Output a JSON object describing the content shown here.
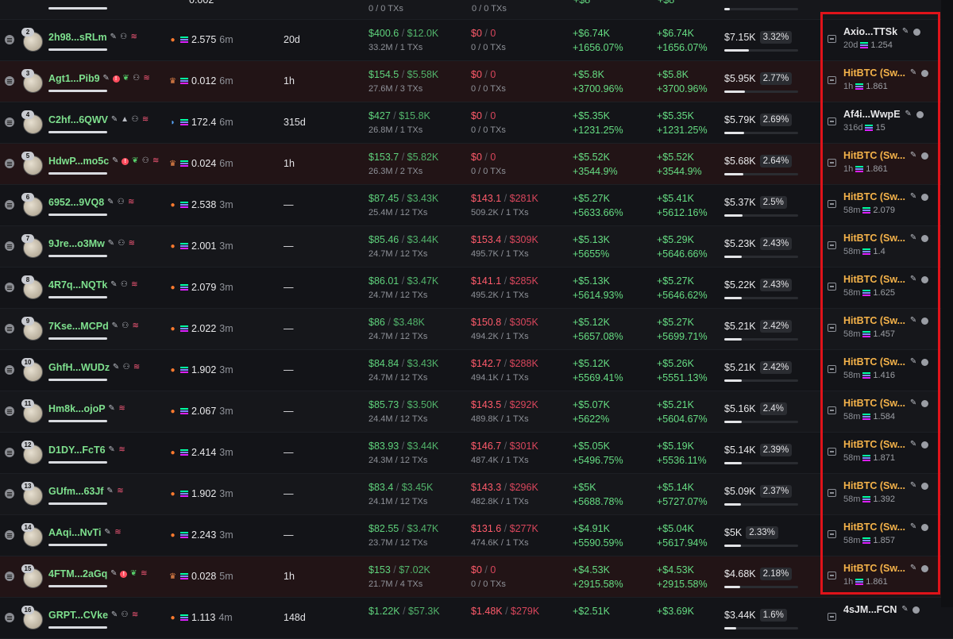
{
  "columns_note": "",
  "top_partial": {
    "balance": "0.002",
    "txs_bought": "0 / 0 TXs",
    "txs_sold": "0 / 0 TXs",
    "pnl1": "+$8",
    "pnl2": "+$8"
  },
  "rows": [
    {
      "rank": "2",
      "wallet": "2h98...sRLm",
      "badges": [
        "edit",
        "user",
        "stack"
      ],
      "alert": false,
      "leaf": false,
      "src": "fire",
      "balance": "2.575",
      "bal_time": "6m",
      "duration": "20d",
      "bought_usd": "$400.6",
      "bought_total": "$12.0K",
      "bought_sub": "33.2M / 1 TXs",
      "sold_usd": "$0",
      "sold_total": "0",
      "sold_sub": "0 / 0 TXs",
      "pnl_a": "+$6.74K",
      "pnl_a_pct": "+1656.07%",
      "pnl_b": "+$6.74K",
      "pnl_b_pct": "+1656.07%",
      "pnl_usd": "$7.15K",
      "pnl_share": "3.32%",
      "bar": 0.33,
      "fund_name": "Axio...TTSk",
      "fund_orange": false,
      "fund_time": "20d",
      "fund_amount": "1.254",
      "tone": "even"
    },
    {
      "rank": "3",
      "wallet": "Agt1...Pib9",
      "badges": [
        "edit",
        "user",
        "stack"
      ],
      "alert": true,
      "leaf": true,
      "src": "crown",
      "balance": "0.012",
      "bal_time": "6m",
      "duration": "1h",
      "bought_usd": "$154.5",
      "bought_total": "$5.58K",
      "bought_sub": "27.6M / 3 TXs",
      "sold_usd": "$0",
      "sold_total": "0",
      "sold_sub": "0 / 0 TXs",
      "pnl_a": "+$5.8K",
      "pnl_a_pct": "+3700.96%",
      "pnl_b": "+$5.8K",
      "pnl_b_pct": "+3700.96%",
      "pnl_usd": "$5.95K",
      "pnl_share": "2.77%",
      "bar": 0.28,
      "fund_name": "HitBTC (Sw...",
      "fund_orange": true,
      "fund_time": "1h",
      "fund_amount": "1.861",
      "tone": "hl"
    },
    {
      "rank": "4",
      "wallet": "C2hf...6QWV",
      "badges": [
        "edit",
        "tri",
        "user",
        "stack"
      ],
      "alert": false,
      "leaf": false,
      "src": "dolphin",
      "balance": "172.4",
      "bal_time": "6m",
      "duration": "315d",
      "bought_usd": "$427",
      "bought_total": "$15.8K",
      "bought_sub": "26.8M / 1 TXs",
      "sold_usd": "$0",
      "sold_total": "0",
      "sold_sub": "0 / 0 TXs",
      "pnl_a": "+$5.35K",
      "pnl_a_pct": "+1231.25%",
      "pnl_b": "+$5.35K",
      "pnl_b_pct": "+1231.25%",
      "pnl_usd": "$5.79K",
      "pnl_share": "2.69%",
      "bar": 0.27,
      "fund_name": "Af4i...WwpE",
      "fund_orange": false,
      "fund_time": "316d",
      "fund_amount": "15",
      "tone": "even"
    },
    {
      "rank": "5",
      "wallet": "HdwP...mo5c",
      "badges": [
        "edit",
        "user",
        "stack"
      ],
      "alert": true,
      "leaf": true,
      "src": "crown",
      "balance": "0.024",
      "bal_time": "6m",
      "duration": "1h",
      "bought_usd": "$153.7",
      "bought_total": "$5.82K",
      "bought_sub": "26.3M / 2 TXs",
      "sold_usd": "$0",
      "sold_total": "0",
      "sold_sub": "0 / 0 TXs",
      "pnl_a": "+$5.52K",
      "pnl_a_pct": "+3544.9%",
      "pnl_b": "+$5.52K",
      "pnl_b_pct": "+3544.9%",
      "pnl_usd": "$5.68K",
      "pnl_share": "2.64%",
      "bar": 0.26,
      "fund_name": "HitBTC (Sw...",
      "fund_orange": true,
      "fund_time": "1h",
      "fund_amount": "1.861",
      "tone": "hl"
    },
    {
      "rank": "6",
      "wallet": "6952...9VQ8",
      "badges": [
        "edit",
        "user",
        "stack"
      ],
      "alert": false,
      "leaf": false,
      "src": "fire",
      "balance": "2.538",
      "bal_time": "3m",
      "duration": "—",
      "bought_usd": "$87.45",
      "bought_total": "$3.43K",
      "bought_sub": "25.4M / 12 TXs",
      "sold_usd": "$143.1",
      "sold_total": "$281K",
      "sold_sub": "509.2K / 1 TXs",
      "pnl_a": "+$5.27K",
      "pnl_a_pct": "+5633.66%",
      "pnl_b": "+$5.41K",
      "pnl_b_pct": "+5612.16%",
      "pnl_usd": "$5.37K",
      "pnl_share": "2.5%",
      "bar": 0.25,
      "fund_name": "HitBTC (Sw...",
      "fund_orange": true,
      "fund_time": "58m",
      "fund_amount": "2.079",
      "tone": "even"
    },
    {
      "rank": "7",
      "wallet": "9Jre...o3Mw",
      "badges": [
        "edit",
        "user",
        "stack"
      ],
      "alert": false,
      "leaf": false,
      "src": "fire",
      "balance": "2.001",
      "bal_time": "3m",
      "duration": "—",
      "bought_usd": "$85.46",
      "bought_total": "$3.44K",
      "bought_sub": "24.7M / 12 TXs",
      "sold_usd": "$153.4",
      "sold_total": "$309K",
      "sold_sub": "495.7K / 1 TXs",
      "pnl_a": "+$5.13K",
      "pnl_a_pct": "+5655%",
      "pnl_b": "+$5.29K",
      "pnl_b_pct": "+5646.66%",
      "pnl_usd": "$5.23K",
      "pnl_share": "2.43%",
      "bar": 0.24,
      "fund_name": "HitBTC (Sw...",
      "fund_orange": true,
      "fund_time": "58m",
      "fund_amount": "1.4",
      "tone": "odd"
    },
    {
      "rank": "8",
      "wallet": "4R7q...NQTk",
      "badges": [
        "edit",
        "user",
        "stack"
      ],
      "alert": false,
      "leaf": false,
      "src": "fire",
      "balance": "2.079",
      "bal_time": "3m",
      "duration": "—",
      "bought_usd": "$86.01",
      "bought_total": "$3.47K",
      "bought_sub": "24.7M / 12 TXs",
      "sold_usd": "$141.1",
      "sold_total": "$285K",
      "sold_sub": "495.2K / 1 TXs",
      "pnl_a": "+$5.13K",
      "pnl_a_pct": "+5614.93%",
      "pnl_b": "+$5.27K",
      "pnl_b_pct": "+5646.62%",
      "pnl_usd": "$5.22K",
      "pnl_share": "2.43%",
      "bar": 0.24,
      "fund_name": "HitBTC (Sw...",
      "fund_orange": true,
      "fund_time": "58m",
      "fund_amount": "1.625",
      "tone": "even"
    },
    {
      "rank": "9",
      "wallet": "7Kse...MCPd",
      "badges": [
        "edit",
        "user",
        "stack"
      ],
      "alert": false,
      "leaf": false,
      "src": "fire",
      "balance": "2.022",
      "bal_time": "3m",
      "duration": "—",
      "bought_usd": "$86",
      "bought_total": "$3.48K",
      "bought_sub": "24.7M / 12 TXs",
      "sold_usd": "$150.8",
      "sold_total": "$305K",
      "sold_sub": "494.2K / 1 TXs",
      "pnl_a": "+$5.12K",
      "pnl_a_pct": "+5657.08%",
      "pnl_b": "+$5.27K",
      "pnl_b_pct": "+5699.71%",
      "pnl_usd": "$5.21K",
      "pnl_share": "2.42%",
      "bar": 0.24,
      "fund_name": "HitBTC (Sw...",
      "fund_orange": true,
      "fund_time": "58m",
      "fund_amount": "1.457",
      "tone": "odd"
    },
    {
      "rank": "10",
      "wallet": "GhfH...WUDz",
      "badges": [
        "edit",
        "user",
        "stack"
      ],
      "alert": false,
      "leaf": false,
      "src": "fire",
      "balance": "1.902",
      "bal_time": "3m",
      "duration": "—",
      "bought_usd": "$84.84",
      "bought_total": "$3.43K",
      "bought_sub": "24.7M / 12 TXs",
      "sold_usd": "$142.7",
      "sold_total": "$288K",
      "sold_sub": "494.1K / 1 TXs",
      "pnl_a": "+$5.12K",
      "pnl_a_pct": "+5569.41%",
      "pnl_b": "+$5.26K",
      "pnl_b_pct": "+5551.13%",
      "pnl_usd": "$5.21K",
      "pnl_share": "2.42%",
      "bar": 0.24,
      "fund_name": "HitBTC (Sw...",
      "fund_orange": true,
      "fund_time": "58m",
      "fund_amount": "1.416",
      "tone": "even"
    },
    {
      "rank": "11",
      "wallet": "Hm8k...ojoP",
      "badges": [
        "edit",
        "stack"
      ],
      "alert": false,
      "leaf": false,
      "src": "fire",
      "balance": "2.067",
      "bal_time": "3m",
      "duration": "—",
      "bought_usd": "$85.73",
      "bought_total": "$3.50K",
      "bought_sub": "24.4M / 12 TXs",
      "sold_usd": "$143.5",
      "sold_total": "$292K",
      "sold_sub": "489.8K / 1 TXs",
      "pnl_a": "+$5.07K",
      "pnl_a_pct": "+5622%",
      "pnl_b": "+$5.21K",
      "pnl_b_pct": "+5604.67%",
      "pnl_usd": "$5.16K",
      "pnl_share": "2.4%",
      "bar": 0.24,
      "fund_name": "HitBTC (Sw...",
      "fund_orange": true,
      "fund_time": "58m",
      "fund_amount": "1.584",
      "tone": "odd"
    },
    {
      "rank": "12",
      "wallet": "D1DY...FcT6",
      "badges": [
        "edit",
        "stack"
      ],
      "alert": false,
      "leaf": false,
      "src": "fire",
      "balance": "2.414",
      "bal_time": "3m",
      "duration": "—",
      "bought_usd": "$83.93",
      "bought_total": "$3.44K",
      "bought_sub": "24.3M / 12 TXs",
      "sold_usd": "$146.7",
      "sold_total": "$301K",
      "sold_sub": "487.4K / 1 TXs",
      "pnl_a": "+$5.05K",
      "pnl_a_pct": "+5496.75%",
      "pnl_b": "+$5.19K",
      "pnl_b_pct": "+5536.11%",
      "pnl_usd": "$5.14K",
      "pnl_share": "2.39%",
      "bar": 0.24,
      "fund_name": "HitBTC (Sw...",
      "fund_orange": true,
      "fund_time": "58m",
      "fund_amount": "1.871",
      "tone": "even"
    },
    {
      "rank": "13",
      "wallet": "GUfm...63Jf",
      "badges": [
        "edit",
        "stack"
      ],
      "alert": false,
      "leaf": false,
      "src": "fire",
      "balance": "1.902",
      "bal_time": "3m",
      "duration": "—",
      "bought_usd": "$83.4",
      "bought_total": "$3.45K",
      "bought_sub": "24.1M / 12 TXs",
      "sold_usd": "$143.3",
      "sold_total": "$296K",
      "sold_sub": "482.8K / 1 TXs",
      "pnl_a": "+$5K",
      "pnl_a_pct": "+5688.78%",
      "pnl_b": "+$5.14K",
      "pnl_b_pct": "+5727.07%",
      "pnl_usd": "$5.09K",
      "pnl_share": "2.37%",
      "bar": 0.23,
      "fund_name": "HitBTC (Sw...",
      "fund_orange": true,
      "fund_time": "58m",
      "fund_amount": "1.392",
      "tone": "odd"
    },
    {
      "rank": "14",
      "wallet": "AAqi...NvTi",
      "badges": [
        "edit",
        "stack"
      ],
      "alert": false,
      "leaf": false,
      "src": "fire",
      "balance": "2.243",
      "bal_time": "3m",
      "duration": "—",
      "bought_usd": "$82.55",
      "bought_total": "$3.47K",
      "bought_sub": "23.7M / 12 TXs",
      "sold_usd": "$131.6",
      "sold_total": "$277K",
      "sold_sub": "474.6K / 1 TXs",
      "pnl_a": "+$4.91K",
      "pnl_a_pct": "+5590.59%",
      "pnl_b": "+$5.04K",
      "pnl_b_pct": "+5617.94%",
      "pnl_usd": "$5K",
      "pnl_share": "2.33%",
      "bar": 0.23,
      "fund_name": "HitBTC (Sw...",
      "fund_orange": true,
      "fund_time": "58m",
      "fund_amount": "1.857",
      "tone": "even"
    },
    {
      "rank": "15",
      "wallet": "4FTM...2aGq",
      "badges": [
        "edit"
      ],
      "alert": true,
      "leaf": true,
      "src": "crown",
      "balance": "0.028",
      "bal_time": "5m",
      "duration": "1h",
      "bought_usd": "$153",
      "bought_total": "$7.02K",
      "bought_sub": "21.7M / 4 TXs",
      "sold_usd": "$0",
      "sold_total": "0",
      "sold_sub": "0 / 0 TXs",
      "pnl_a": "+$4.53K",
      "pnl_a_pct": "+2915.58%",
      "pnl_b": "+$4.53K",
      "pnl_b_pct": "+2915.58%",
      "pnl_usd": "$4.68K",
      "pnl_share": "2.18%",
      "bar": 0.22,
      "fund_name": "HitBTC (Sw...",
      "fund_orange": true,
      "fund_time": "1h",
      "fund_amount": "1.861",
      "tone": "hl"
    },
    {
      "rank": "16",
      "wallet": "GRPT...CVke",
      "badges": [
        "edit",
        "user",
        "stack"
      ],
      "alert": false,
      "leaf": false,
      "src": "fire",
      "balance": "1.113",
      "bal_time": "4m",
      "duration": "148d",
      "bought_usd": "$1.22K",
      "bought_total": "$57.3K",
      "bought_sub": "",
      "sold_usd": "$1.48K",
      "sold_total": "$279K",
      "sold_sub": "",
      "pnl_a": "+$2.51K",
      "pnl_a_pct": "",
      "pnl_b": "+$3.69K",
      "pnl_b_pct": "",
      "pnl_usd": "$3.44K",
      "pnl_share": "1.6%",
      "bar": 0.16,
      "fund_name": "4sJM...FCN",
      "fund_orange": false,
      "fund_time": "",
      "fund_amount": "",
      "tone": "even"
    }
  ],
  "icons": {
    "edit": "pencil-icon",
    "user": "user-plus-icon",
    "stack": "layers-icon",
    "tri": "triangle-icon",
    "fire": "fire-icon",
    "crown": "crown-icon",
    "dolphin": "dolphin-icon"
  },
  "colors": {
    "wallet_green": "#7ee08e",
    "gain_green": "#5fd27c",
    "loss_red": "#ff5b6b",
    "funding_orange": "#f5b34a",
    "highlight_border": "#e0131a"
  }
}
